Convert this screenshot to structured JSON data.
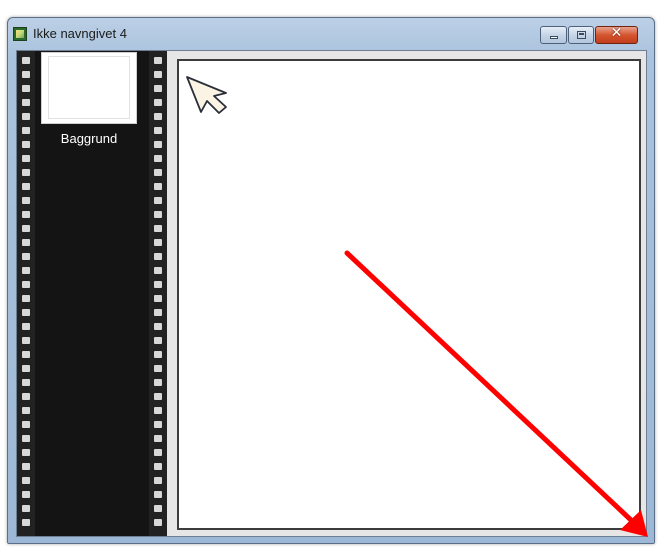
{
  "window": {
    "title": "Ikke navngivet 4",
    "icon": "image-document-icon",
    "buttons": {
      "minimize_icon": "minimize-icon",
      "maximize_icon": "maximize-icon",
      "close_glyph": "✕"
    }
  },
  "filmstrip": {
    "frames": [
      {
        "label": "Baggrund"
      }
    ]
  },
  "colors": {
    "annotation_arrow": "#ff0000",
    "filmstrip_bg": "#141414",
    "close_button": "#c8462a",
    "titlebar": "#b5cbe3"
  }
}
